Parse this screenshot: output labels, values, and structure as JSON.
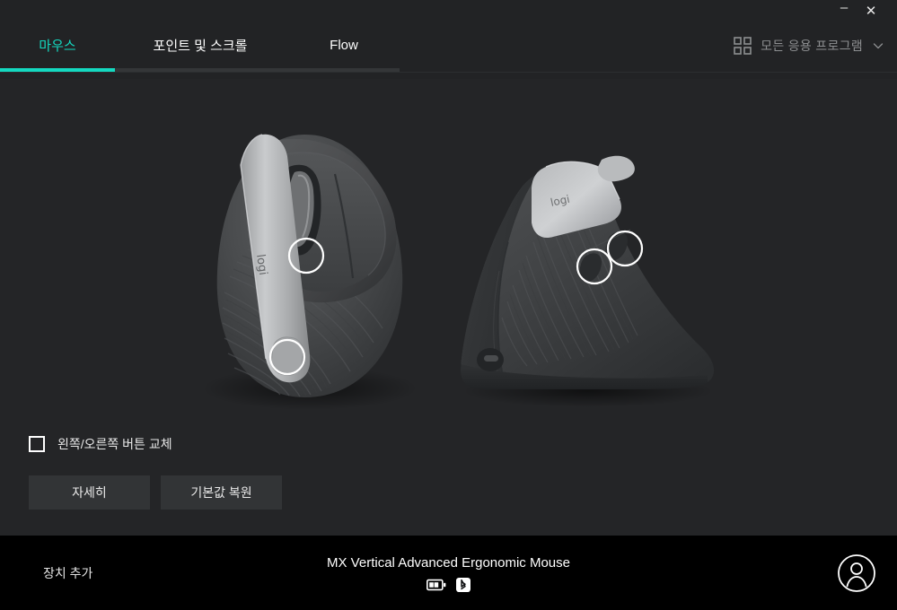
{
  "window": {
    "minimize_label": "–",
    "close_label": "✕"
  },
  "header": {
    "tabs": [
      {
        "label": "마우스",
        "active": true
      },
      {
        "label": "포인트 및 스크롤",
        "active": false
      },
      {
        "label": "Flow",
        "active": false
      }
    ],
    "active_tab_color": "#14d9c0",
    "app_selector": {
      "grid_icon": "grid-icon",
      "label": "모든 응용 프로그램",
      "chevron_icon": "chevron-down-icon"
    }
  },
  "main": {
    "device_image_top_alt": "MX Vertical mouse top view",
    "device_image_side_alt": "MX Vertical mouse side view",
    "brand_mark": "logi",
    "checkbox": {
      "label": "왼쪽/오른쪽 버튼 교체",
      "checked": false
    },
    "buttons": {
      "details_label": "자세히",
      "restore_defaults_label": "기본값 복원"
    }
  },
  "footer": {
    "add_device_label": "장치 추가",
    "device_name": "MX Vertical Advanced Ergonomic Mouse",
    "badges": [
      {
        "icon": "battery-icon",
        "name": "battery-status"
      },
      {
        "icon": "bluetooth-icon",
        "name": "bluetooth-status"
      }
    ],
    "account_icon": "user-avatar-icon"
  },
  "colors": {
    "background": "#242527",
    "header": "#222325",
    "footer": "#000000",
    "accent": "#14d9c0",
    "button": "#323436",
    "text": "#e9e9e9",
    "muted_text": "#8d8f91"
  }
}
